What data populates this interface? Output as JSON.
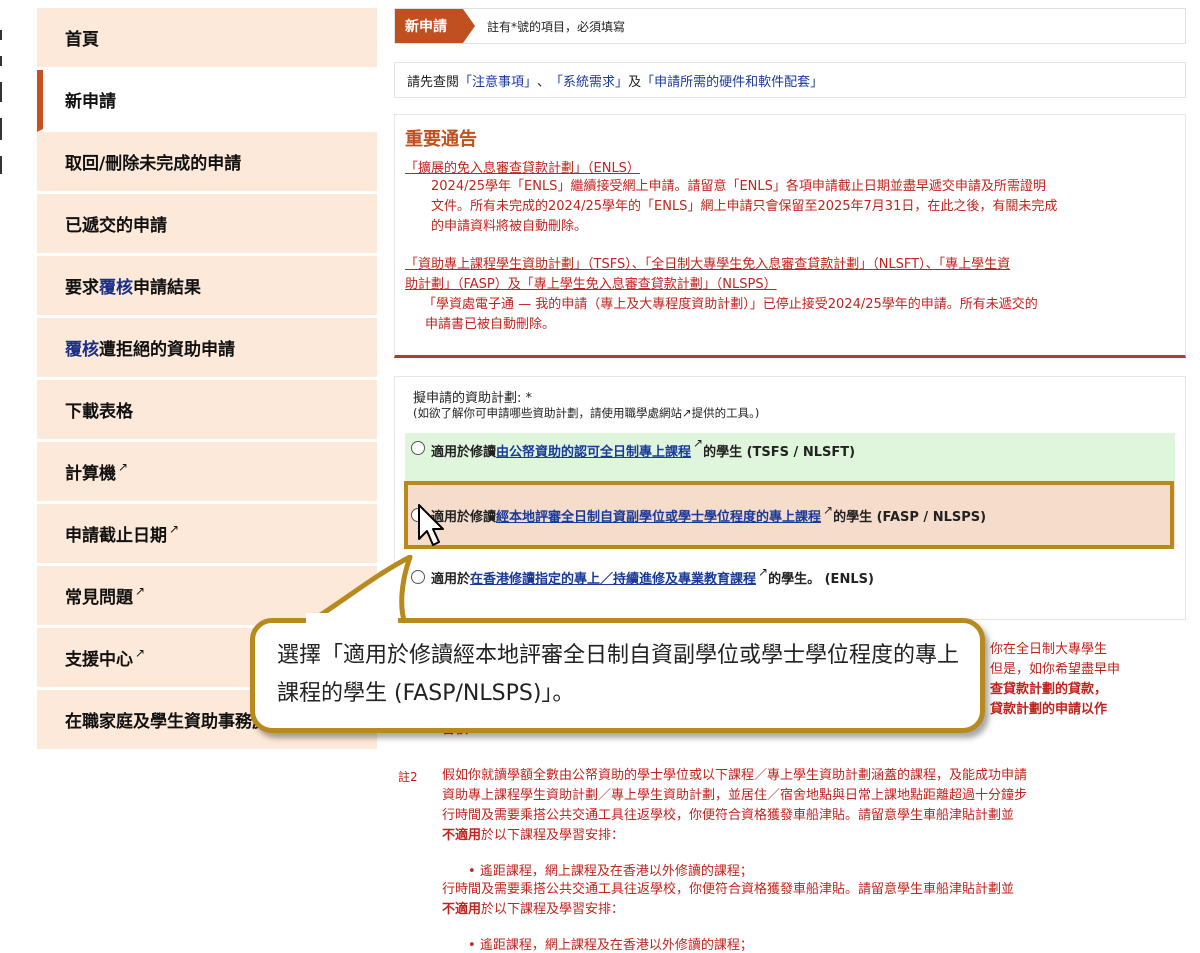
{
  "sidebar": {
    "items": [
      {
        "label": "首頁"
      },
      {
        "label": "新申請"
      },
      {
        "label": "取回/刪除未完成的申請"
      },
      {
        "label": "已遞交的申請"
      },
      {
        "pre": "要求",
        "em": "覆核",
        "post": "申請結果"
      },
      {
        "pre": "",
        "em": "覆核",
        "post": "遭拒絕的資助申請"
      },
      {
        "label": "下載表格"
      },
      {
        "label": "計算機"
      },
      {
        "label": "申請截止日期"
      },
      {
        "label": "常見問題"
      },
      {
        "label": "支援中心"
      },
      {
        "label": "在職家庭及學生資助事務處"
      }
    ],
    "external_icon": "↗"
  },
  "header": {
    "tab": "新申請",
    "note": "註有*號的項目，必須填寫"
  },
  "links": {
    "prefix": "請先查閱",
    "l1": "「注意事項」",
    "sep1": "、",
    "l2": "「系統需求」",
    "sep2": "及",
    "l3": "「申請所需的硬件和軟件配套」"
  },
  "notice": {
    "title": "重要通告",
    "head1": "「擴展的免入息審查貸款計劃」（ENLS）",
    "p1_line1": "2024/25學年「ENLS」繼續接受網上申請。請留意「ENLS」各項申請截止日期並盡早遞交申請及所需證明",
    "p1_line2": "文件。所有未完成的2024/25學年的「ENLS」網上申請只會保留至2025年7月31日，在此之後，有關未完成",
    "p1_line3": "的申請資料將被自動刪除。",
    "head2_line1": "「資助專上課程學生資助計劃」（TSFS）、「全日制大專學生免入息審查貸款計劃」（NLSFT）、「專上學生資",
    "head2_line2": "助計劃」（FASP）及「專上學生免入息審查貸款計劃」（NLSPS）",
    "p2_line1": "「學資處電子通 — 我的申請（專上及大專程度資助計劃）」已停止接受2024/25學年的申請。所有未遞交的",
    "p2_line2": "申請書已被自動刪除。"
  },
  "form": {
    "label": "擬申請的資助計劃: *",
    "hint": "(如欲了解你可申請哪些資助計劃，請使用職學處網站↗提供的工具。)",
    "options": [
      {
        "pre": "適用於修讀",
        "link": "由公帑資助的認可全日制專上課程",
        "post": "的學生 (TSFS / NLSFT)"
      },
      {
        "pre": "適用於修讀",
        "link": "經本地評審全日制自資副學位或學士學位程度的專上課程",
        "post": "的學生 (FASP / NLSPS)"
      },
      {
        "pre": "適用於",
        "link": "在香港修讀指定的專上／持續進修及專業教育課程",
        "post": "的學生。 (ENLS)"
      }
    ]
  },
  "lower": {
    "r1": "你在全日制大專學生",
    "r2": "但是，如你希望盡早申",
    "r3": "查貸款計劃的貸款，",
    "r4": "貸款計劃的申請以作",
    "r5": "審核",
    "note2_label": "註2",
    "n2_l1": "假如你就讀學額全數由公帑資助的學士學位或以下課程／專上學生資助計劃涵蓋的課程，及能成功申請",
    "n2_l2": "資助專上課程學生資助計劃／專上學生資助計劃，並居住／宿舍地點與日常上課地點距離超過十分鐘步",
    "n2_l3": "行時間及需要乘搭公共交通工具往返學校，你便符合資格獲發車船津貼。請留意學生車船津貼計劃並",
    "n2_l4_bold": "不適用",
    "n2_l4_rest": "於以下課程及學習安排：",
    "bullet1": "遙距課程，網上課程及在香港以外修讀的課程；",
    "dup_l1": "行時間及需要乘搭公共交通工具往返學校，你便符合資格獲發車船津貼。請留意學生車船津貼計劃並",
    "dup_l2_bold": "不適用",
    "dup_l2_rest": "於以下課程及學習安排：",
    "bullet2": "遙距課程，網上課程及在香港以外修讀的課程；"
  },
  "callout": {
    "text": "選擇「適用於修讀經本地評審全日制自資副學位或學士學位程度的專上課程的學生 (FASP/NLSPS)」。"
  },
  "colors": {
    "accent": "#c0501f",
    "sidebar_bg": "#fde9d9",
    "notice_red": "#c0241f",
    "link_blue": "#1a3a9a",
    "highlight_gold": "#b88a1e"
  }
}
